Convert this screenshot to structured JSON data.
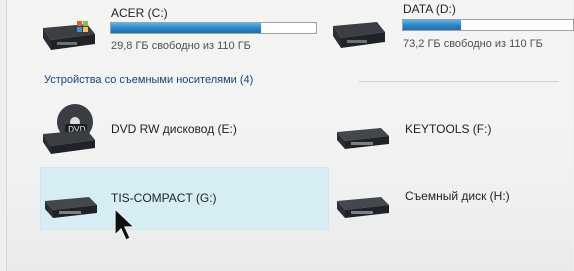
{
  "drives": [
    {
      "name": "ACER (C:)",
      "free_text": "29,8 ГБ свободно из 110 ГБ",
      "used_fraction": 0.73,
      "icon": "hard-drive-windows-icon"
    },
    {
      "name": "DATA (D:)",
      "free_text": "73,2 ГБ свободно из 110 ГБ",
      "used_fraction": 0.34,
      "icon": "hard-drive-icon"
    }
  ],
  "removable_group": {
    "header": "Устройства со съемными носителями (4)",
    "items": [
      {
        "name": "DVD RW дисковод (E:)",
        "icon": "dvd-drive-icon"
      },
      {
        "name": "KEYTOOLS (F:)",
        "icon": "removable-drive-icon"
      },
      {
        "name": "TIS-COMPACT (G:)",
        "icon": "removable-drive-icon"
      },
      {
        "name": "Съемный диск (H:)",
        "icon": "removable-drive-icon"
      }
    ]
  },
  "colors": {
    "bar_fill": "#2f86c6",
    "selection": "#d6eef3",
    "header_text": "#1e3e86"
  }
}
